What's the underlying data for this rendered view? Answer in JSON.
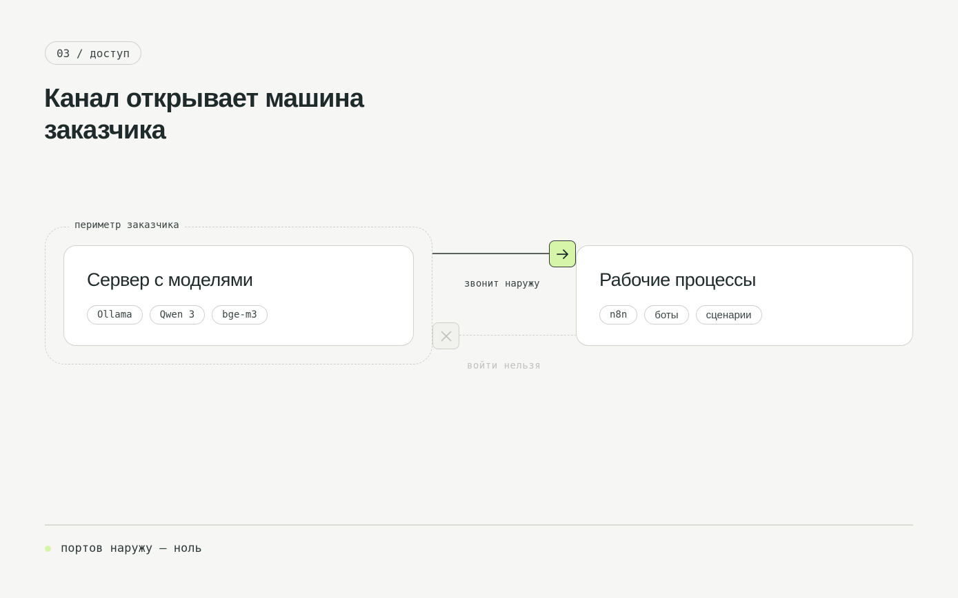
{
  "section_tag": "03 / доступ",
  "title": "Канал открывает машина заказчика",
  "perimeter_label": "периметр заказчика",
  "server": {
    "title": "Сервер с моделями",
    "chips": [
      "Ollama",
      "Qwen 3",
      "bge-m3"
    ]
  },
  "workflows": {
    "title": "Рабочие процессы",
    "chips": [
      "n8n",
      "боты",
      "сценарии"
    ]
  },
  "outbound_label": "звонит наружу",
  "inbound_label": "войти нельзя",
  "footer_text": "портов наружу — ноль",
  "icons": {
    "outbound": "arrow-right-icon",
    "inbound": "close-icon"
  },
  "colors": {
    "accent": "#d6f5a8",
    "background": "#f6f6f4",
    "text": "#1f2a2a",
    "muted": "#bfc2bd"
  }
}
